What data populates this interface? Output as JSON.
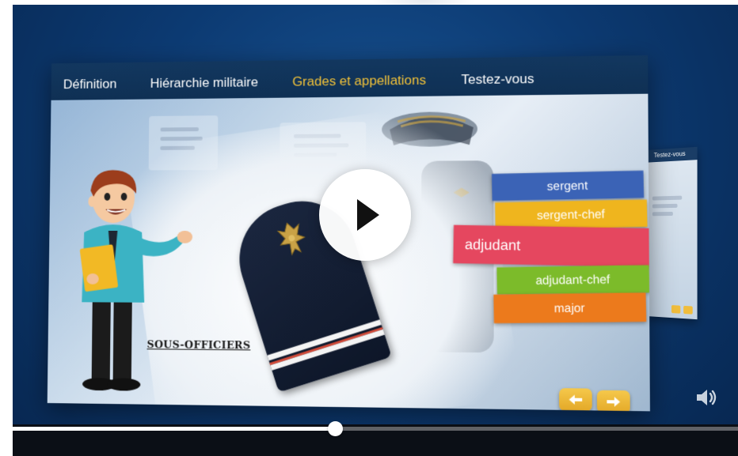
{
  "nav": {
    "tabs": [
      {
        "label": "Définition",
        "active": false
      },
      {
        "label": "Hiérarchie militaire",
        "active": false
      },
      {
        "label": "Grades et appellations",
        "active": true
      },
      {
        "label": "Testez-vous",
        "active": false
      }
    ]
  },
  "slide": {
    "caption": "SOUS-OFFICIERS"
  },
  "ranks": [
    {
      "label": "sergent",
      "color": "#3b63b6"
    },
    {
      "label": "sergent-chef",
      "color": "#efb51e"
    },
    {
      "label": "adjudant",
      "color": "#e5475f"
    },
    {
      "label": "adjudant-chef",
      "color": "#7cbb2a"
    },
    {
      "label": "major",
      "color": "#ec7a1c"
    }
  ],
  "side_slide": {
    "header": "Testez-vous"
  },
  "player": {
    "progress_fraction": 0.444
  },
  "colors": {
    "accent": "#f2c238",
    "nav_background": "#12375f",
    "arrow_button": "#f0bd3d"
  },
  "icons": {
    "play": "play-icon",
    "volume": "volume-icon",
    "prev": "arrow-left-icon",
    "next": "arrow-right-icon"
  }
}
